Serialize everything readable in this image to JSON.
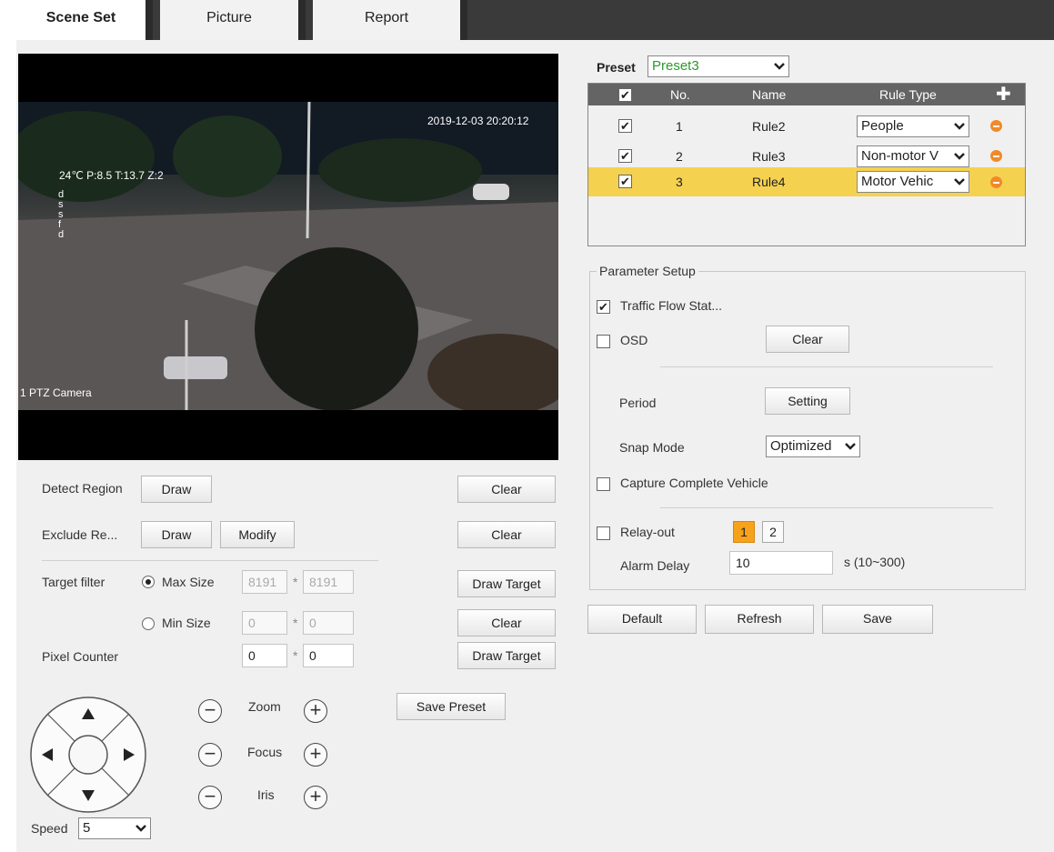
{
  "tabs": [
    {
      "label": "Scene Set",
      "active": true
    },
    {
      "label": "Picture"
    },
    {
      "label": "Report"
    }
  ],
  "video": {
    "timestamp": "2019-12-03 20:20:12",
    "osd_info": "24℃ P:8.5 T:13.7 Z:2",
    "side_chars": "d\ns\ns\nf\nd",
    "camera_name": "1 PTZ Camera"
  },
  "detect_region": {
    "label": "Detect Region",
    "draw": "Draw",
    "clear": "Clear"
  },
  "exclude_region": {
    "label": "Exclude Re...",
    "draw": "Draw",
    "modify": "Modify",
    "clear": "Clear"
  },
  "target_filter": {
    "label": "Target filter",
    "max": {
      "label": "Max Size",
      "w": "8191",
      "h": "8191",
      "selected": true
    },
    "min": {
      "label": "Min Size",
      "w": "0",
      "h": "0"
    },
    "times": "*",
    "draw_target": "Draw Target",
    "clear": "Clear"
  },
  "pixel_counter": {
    "label": "Pixel Counter",
    "w": "0",
    "h": "0",
    "draw_target": "Draw Target"
  },
  "ptz": {
    "zoom": "Zoom",
    "focus": "Focus",
    "iris": "Iris",
    "minus": "−",
    "plus": "+",
    "save_preset": "Save Preset",
    "speed_label": "Speed",
    "speed_value": "5"
  },
  "preset": {
    "label": "Preset",
    "value": "Preset3"
  },
  "rules_table": {
    "headers": {
      "no": "No.",
      "name": "Name",
      "rule_type": "Rule Type"
    },
    "rows": [
      {
        "no": "1",
        "name": "Rule2",
        "type": "People"
      },
      {
        "no": "2",
        "name": "Rule3",
        "type": "Non-motor V"
      },
      {
        "no": "3",
        "name": "Rule4",
        "type": "Motor Vehic",
        "selected": true
      }
    ]
  },
  "params": {
    "legend": "Parameter Setup",
    "traffic_flow": "Traffic Flow Stat...",
    "osd": "OSD",
    "osd_clear": "Clear",
    "period": "Period",
    "period_btn": "Setting",
    "snap_mode": "Snap Mode",
    "snap_value": "Optimized",
    "capture_complete": "Capture Complete Vehicle",
    "relay_out": "Relay-out",
    "relay_1": "1",
    "relay_2": "2",
    "alarm_delay": "Alarm Delay",
    "alarm_delay_value": "10",
    "alarm_delay_range": "s (10~300)"
  },
  "footer": {
    "default": "Default",
    "refresh": "Refresh",
    "save": "Save"
  },
  "colors": {
    "accent": "#f7a21b",
    "header": "#646464",
    "preset_text": "#2a9a2a",
    "remove": "#f08a2a"
  }
}
